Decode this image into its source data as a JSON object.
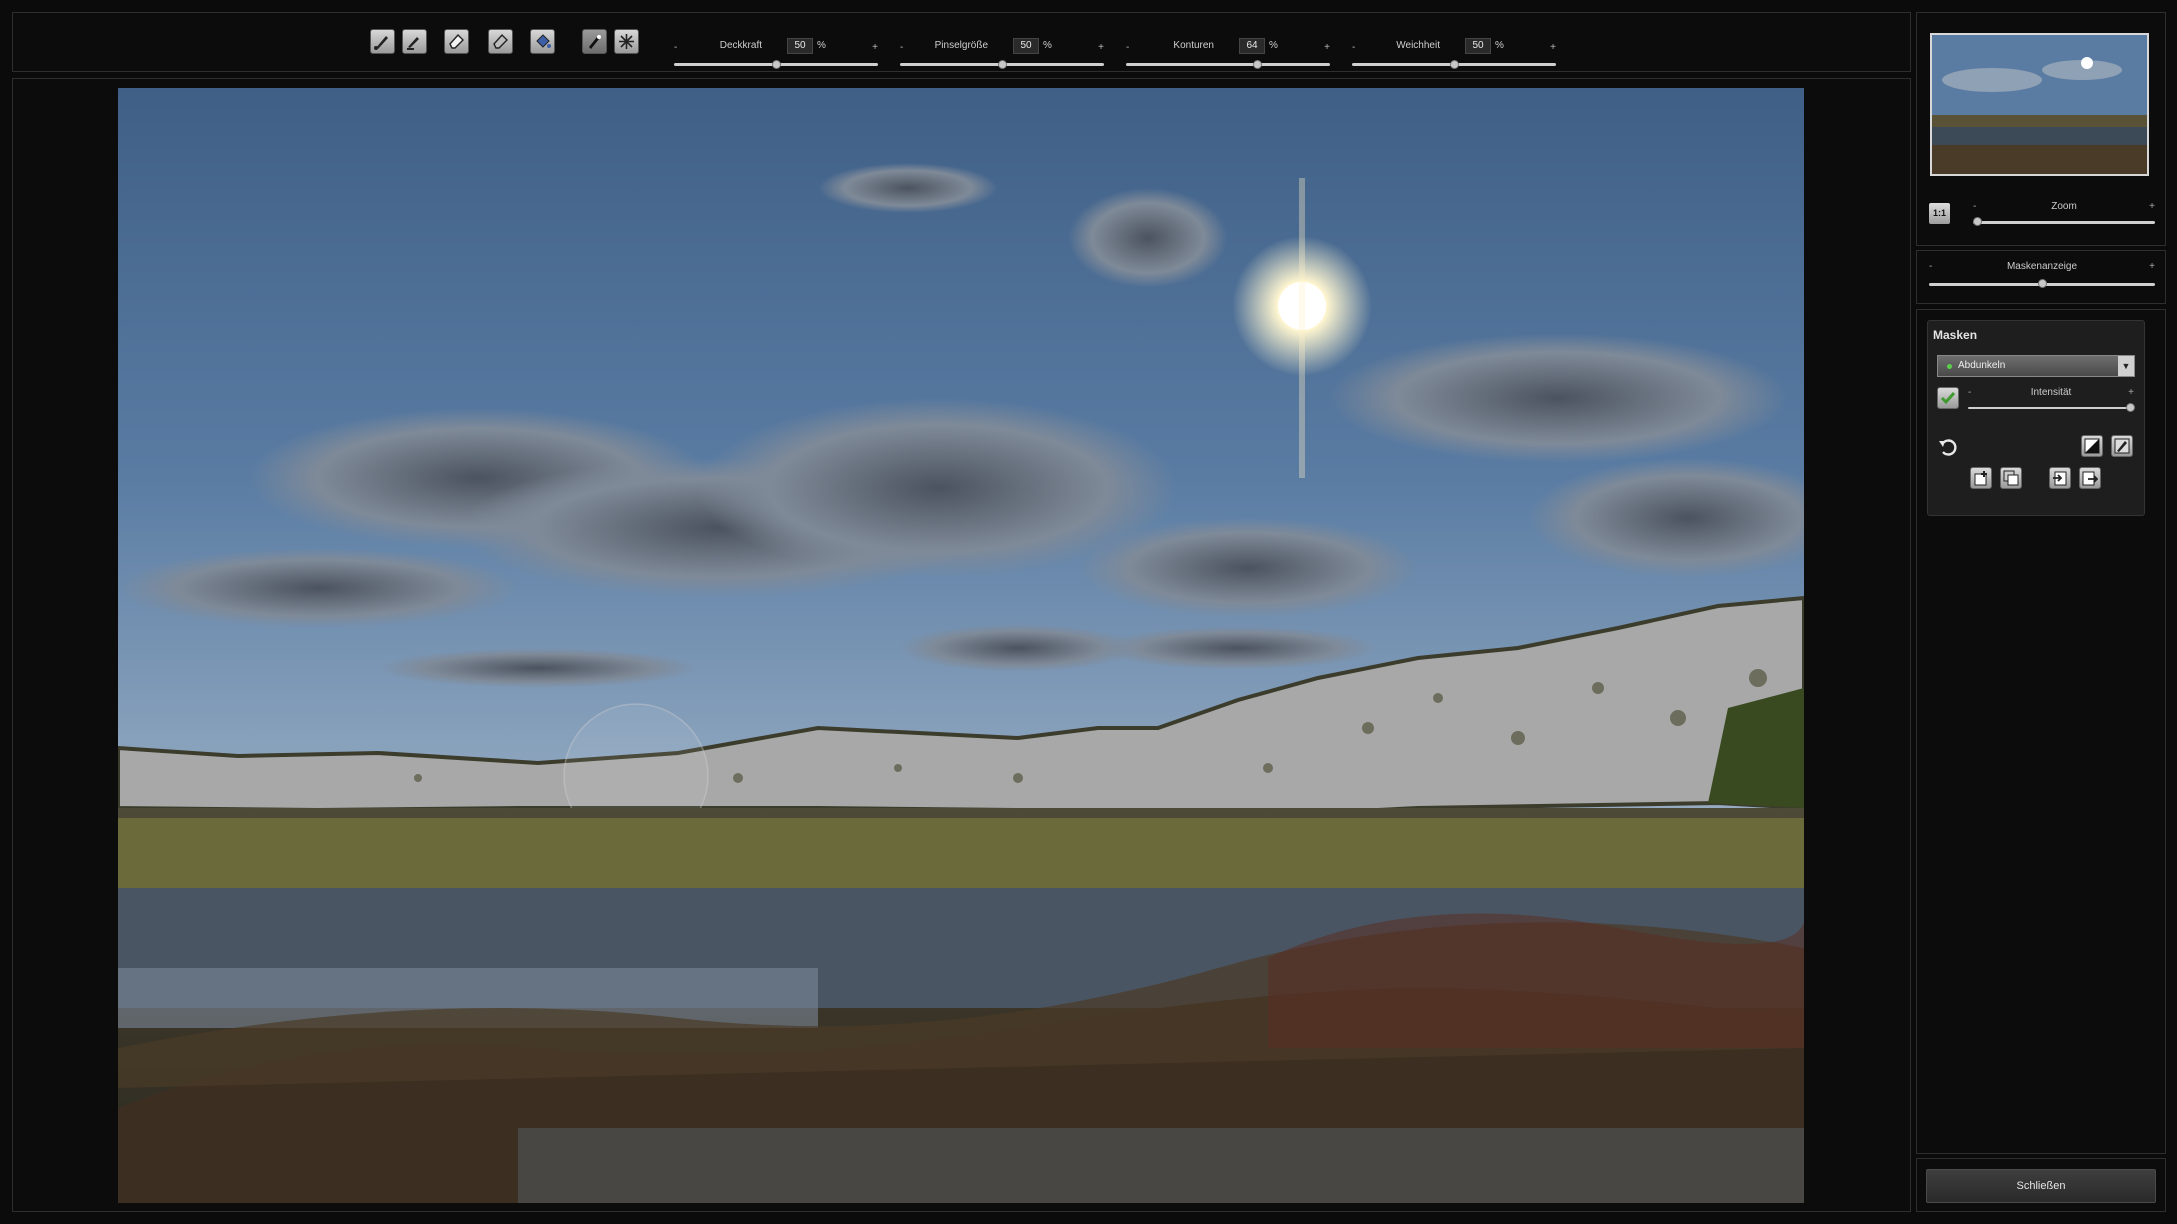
{
  "toolbar": {
    "tools": [
      {
        "name": "brush-tool-icon",
        "active": false
      },
      {
        "name": "brush-erase-tool-icon",
        "active": false
      },
      {
        "name": "eraser-tool-icon",
        "active": false
      },
      {
        "name": "eraser-soft-tool-icon",
        "active": false
      },
      {
        "name": "fill-tool-icon",
        "active": false
      },
      {
        "name": "magic-brush-tool-icon",
        "active": true
      },
      {
        "name": "magic-wand-tool-icon",
        "active": false
      }
    ],
    "sliders": [
      {
        "label": "Deckkraft",
        "value": "50",
        "unit": "%",
        "minus": "-",
        "plus": "+",
        "level": 0.5
      },
      {
        "label": "Pinselgröße",
        "value": "50",
        "unit": "%",
        "minus": "-",
        "plus": "+",
        "level": 0.5
      },
      {
        "label": "Konturen",
        "value": "64",
        "unit": "%",
        "minus": "-",
        "plus": "+",
        "level": 0.64
      },
      {
        "label": "Weichheit",
        "value": "50",
        "unit": "%",
        "minus": "-",
        "plus": "+",
        "level": 0.5
      }
    ]
  },
  "navigator": {
    "zoom_label": "Zoom",
    "zoom_minus": "-",
    "zoom_plus": "+",
    "zoom_level": 0.0,
    "one_to_one_label": "1:1"
  },
  "mask_display": {
    "label": "Maskenanzeige",
    "minus": "-",
    "plus": "+",
    "level": 0.5
  },
  "masks": {
    "title": "Masken",
    "selected_mask": "Abdunkeln",
    "selected_color": "#5ad04a",
    "intensity_label": "Intensität",
    "intensity_minus": "-",
    "intensity_plus": "+",
    "intensity_level": 1.0
  },
  "footer": {
    "close_label": "Schließen"
  },
  "colors": {
    "background": "#0b0b0b",
    "panel_border": "#2e2e2e",
    "accent_green": "#5ad04a"
  }
}
